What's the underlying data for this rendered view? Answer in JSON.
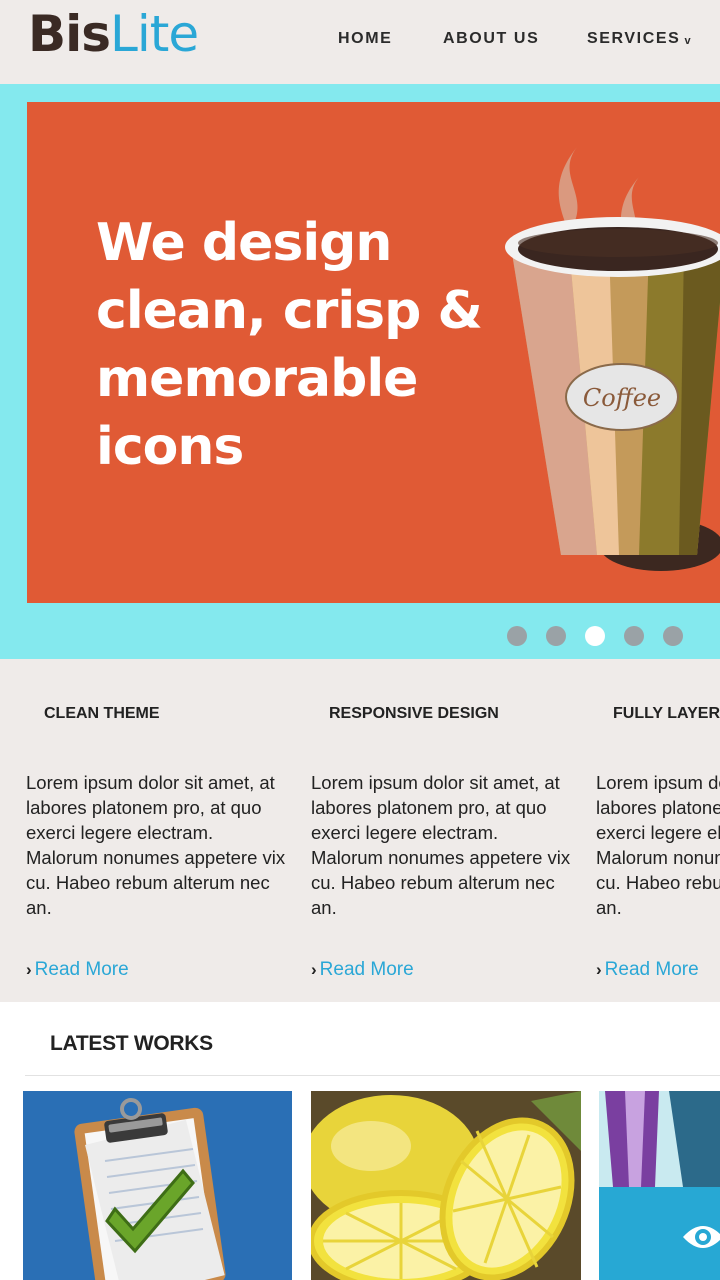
{
  "brand": {
    "name_part1": "Bis",
    "name_part2": "Lite"
  },
  "nav": {
    "home": "HOME",
    "about": "ABOUT US",
    "services": "SERVICES",
    "services_chevron": "v"
  },
  "hero": {
    "lines": [
      "We design",
      "clean, crisp &",
      "memorable",
      "icons"
    ],
    "cup_label": "Coffee",
    "active_slide": 3,
    "slide_count": 5
  },
  "features": [
    {
      "title": "CLEAN THEME",
      "text": "Lorem ipsum dolor sit amet, at labores platonem pro, at quo exerci legere electram. Malorum nonumes appetere vix cu. Habeo rebum alterum nec an.",
      "link": "Read More"
    },
    {
      "title": "RESPONSIVE DESIGN",
      "text": "Lorem ipsum dolor sit amet, at labores platonem pro, at quo exerci legere electram. Malorum nonumes appetere vix cu. Habeo rebum alterum nec an.",
      "link": "Read More"
    },
    {
      "title": "FULLY LAYERED",
      "text": "Lorem ipsum dolor sit amet, at labores platonem pro, at quo exerci legere electram. Malorum nonumes appetere vix cu. Habeo rebum alterum nec an.",
      "link": "Read More"
    }
  ],
  "works": {
    "title": "LATEST WORKS"
  },
  "colors": {
    "accent": "#2aa7d6",
    "hero_bg": "#84e9ee",
    "slide_bg": "#e05a35",
    "page_bg": "#efebe9"
  },
  "icons": [
    "chevron-right-icon",
    "eye-icon",
    "clipboard-check-icon",
    "lemon-icon",
    "coffee-cup-icon"
  ]
}
